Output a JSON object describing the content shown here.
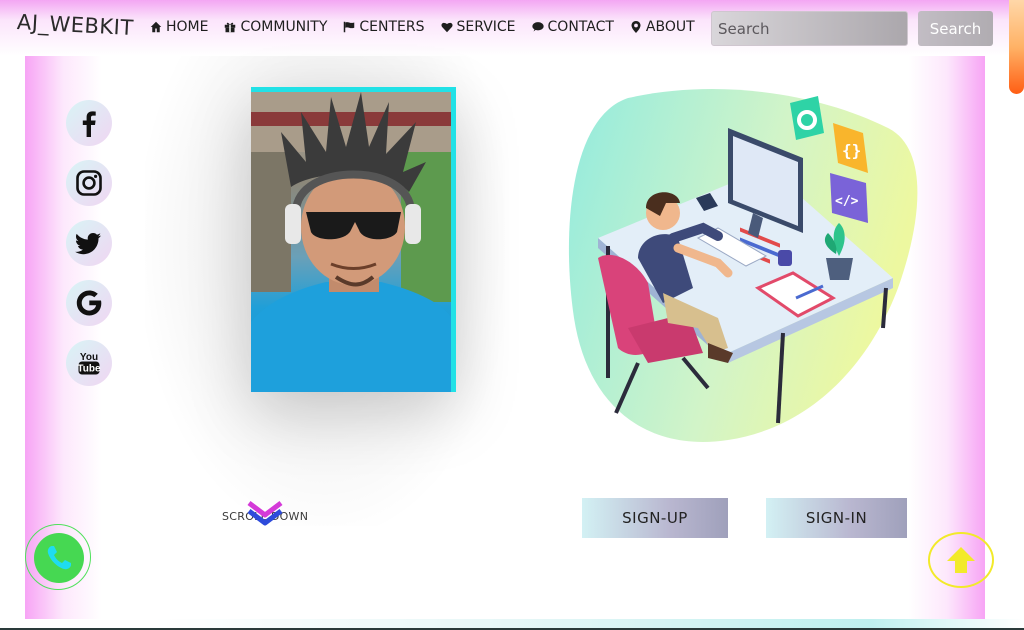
{
  "brand": {
    "name": "AJ_WEBKIT"
  },
  "nav": {
    "items": [
      {
        "label": "HOME",
        "icon": "home-icon"
      },
      {
        "label": "COMMUNITY",
        "icon": "gift-icon"
      },
      {
        "label": "CENTERS",
        "icon": "flag-icon"
      },
      {
        "label": "SERVICE",
        "icon": "heart-icon"
      },
      {
        "label": "CONTACT",
        "icon": "chat-icon"
      },
      {
        "label": "ABOUT",
        "icon": "map-marker-icon"
      }
    ]
  },
  "search": {
    "placeholder": "Search",
    "button_label": "Search"
  },
  "social": [
    {
      "name": "facebook-icon"
    },
    {
      "name": "instagram-icon"
    },
    {
      "name": "twitter-icon"
    },
    {
      "name": "google-icon"
    },
    {
      "name": "youtube-icon",
      "text_top": "You",
      "text_bottom": "Tube"
    }
  ],
  "hero": {
    "scroll_label": "SCROLL DOWN",
    "signup_label": "SIGN-UP",
    "signin_label": "SIGN-IN"
  },
  "colors": {
    "accent_pink": "#f7a4f5",
    "frame_cyan": "#21e1e6",
    "phone_green": "#46d852",
    "arrow_yellow": "#f2ea2a",
    "chevron_magenta": "#d43ad8",
    "chevron_blue": "#2d4bdb"
  }
}
